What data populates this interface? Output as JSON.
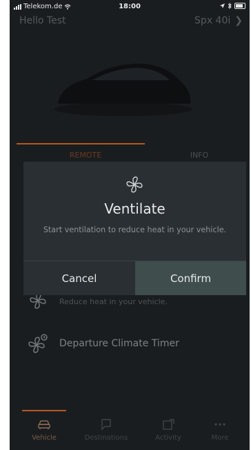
{
  "status_bar": {
    "carrier": "Telekom.de",
    "time": "18:00"
  },
  "header": {
    "greeting": "Hello Test",
    "vehicle": "Spx 40i"
  },
  "tabs": [
    {
      "label": "REMOTE",
      "active": true
    },
    {
      "label": "INFO",
      "active": false
    }
  ],
  "features": [
    {
      "title": "",
      "subtitle": "Reduce heat in your vehicle.",
      "icon": "fan-icon"
    },
    {
      "title": "Departure Climate Timer",
      "subtitle": "",
      "icon": "fan-timer-icon"
    }
  ],
  "modal": {
    "icon": "fan-icon",
    "title": "Ventilate",
    "description": "Start ventilation to reduce heat in your vehicle.",
    "cancel_label": "Cancel",
    "confirm_label": "Confirm"
  },
  "bottom_nav": [
    {
      "label": "Vehicle",
      "icon": "car-icon",
      "active": true
    },
    {
      "label": "Destinations",
      "icon": "chat-icon",
      "active": false
    },
    {
      "label": "Activity",
      "icon": "activity-icon",
      "active": false
    },
    {
      "label": "More",
      "icon": "more-icon",
      "active": false
    }
  ],
  "colors": {
    "background": "#1a1d20",
    "accent": "#b35a1f",
    "modal": "#2a2f33",
    "confirm_button": "#3f4d4c"
  }
}
